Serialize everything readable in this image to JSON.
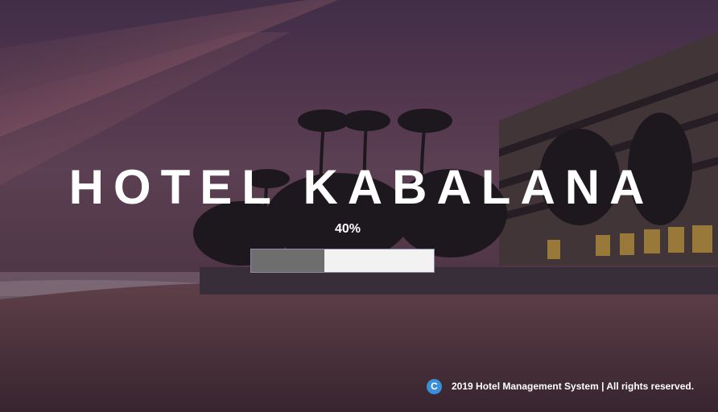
{
  "app": {
    "title": "HOTEL KABALANA"
  },
  "progress": {
    "percent_label": "40%",
    "value": 0.4
  },
  "footer": {
    "icon": "copyright-icon",
    "icon_glyph": "C",
    "text": "2019 Hotel Management System | All rights reserved."
  },
  "colors": {
    "progress_fill": "#6e6e6e",
    "progress_track": "#f2f2f2",
    "icon_background": "#3a8fd8",
    "text": "#ffffff"
  }
}
